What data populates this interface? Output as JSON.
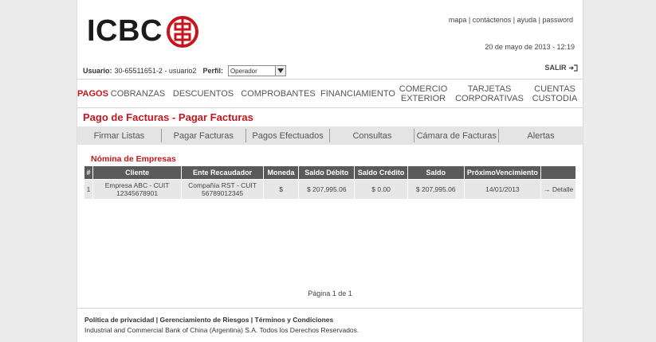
{
  "header": {
    "logo_text": "ICBC",
    "links": [
      "mapa",
      "contáctenos",
      "ayuda",
      "password"
    ],
    "link_sep": " | ",
    "datetime": "20 de mayo de 2013 - 12:19"
  },
  "userbar": {
    "user_label": "Usuario:",
    "user_value": "30-65511651-2 - usuario2",
    "perfil_label": "Perfil:",
    "perfil_value": "Operador",
    "logout": "SALIR"
  },
  "main_nav": [
    {
      "label": "PAGOS",
      "active": true
    },
    {
      "label": "COBRANZAS"
    },
    {
      "label": "DESCUENTOS"
    },
    {
      "label": "COMPROBANTES"
    },
    {
      "label": "FINANCIAMIENTO"
    },
    {
      "label": "COMERCIO\nEXTERIOR"
    },
    {
      "label": "TARJETAS\nCORPORATIVAS"
    },
    {
      "label": "CUENTAS\nCUSTODIA"
    }
  ],
  "page_title": "Pago de Facturas - Pagar Facturas",
  "sub_nav": [
    "Firmar Listas",
    "Pagar Facturas",
    "Pagos Efectuados",
    "Consultas",
    "Cámara de Facturas",
    "Alertas"
  ],
  "section_title": "Nómina de Empresas",
  "table": {
    "headers": [
      "#",
      "Cliente",
      "Ente Recaudador",
      "Moneda",
      "Saldo Débito",
      "Saldo Crédito",
      "Saldo",
      "PróximoVencimiento",
      ""
    ],
    "rows": [
      {
        "num": "1",
        "cliente_1": "Empresa ABC - CUIT",
        "cliente_2": "12345678901",
        "ente_1": "Compañía RST - CUIT",
        "ente_2": "56789012345",
        "moneda": "$",
        "saldo_debito": "$ 207,995.06",
        "saldo_credito": "$ 0.00",
        "saldo": "$ 207,995.06",
        "vencimiento": "14/01/2013",
        "detalle": "→ Detalle"
      }
    ]
  },
  "pager": "Página 1 de 1",
  "footer": {
    "links": "Política de privacidad | Gerenciamiento de Riesgos | Términos y Condiciones",
    "copyright": "Industrial and Commercial Bank of China (Argentina) S.A. Todos los Derechos Reservados."
  },
  "colors": {
    "brand_red": "#c4161c",
    "header_gray": "#5a5a5a",
    "subnav_bg": "#e4e4e4"
  },
  "icons": {
    "logo_mark": "icbc-logo-icon",
    "logout": "logout-icon",
    "dropdown": "chevron-down-icon"
  }
}
